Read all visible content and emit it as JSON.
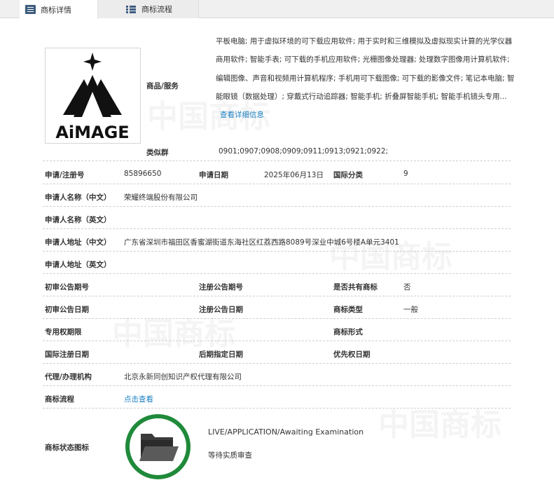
{
  "tabs": [
    {
      "label": "商标详情",
      "active": true
    },
    {
      "label": "商标流程",
      "active": false
    }
  ],
  "watermark": {
    "text": "中国商标"
  },
  "logo": {
    "text": "AiMAGE",
    "color": "#111111"
  },
  "goods": {
    "label": "商品/服务",
    "text": "平板电脑; 用于虚拟环境的可下载应用软件; 用于实时和三维模拟及虚拟现实计算的光学仪器商用软件; 智能手表; 可下载的手机应用软件; 光栅图像处理器; 处理数字图像用计算机软件; 编辑图像、声音和视频用计算机程序; 手机用可下载图像; 可下载的影像文件; 笔记本电脑; 智能眼镜（数据处理）; 穿戴式行动追踪器; 智能手机; 折叠屏智能手机; 智能手机镜头专用...",
    "more_link": "查看详细信息"
  },
  "similar_group": {
    "label": "类似群",
    "value": "0901;0907;0908;0909;0911;0913;0921;0922;"
  },
  "fields": {
    "reg_no_label": "申请/注册号",
    "reg_no": "85896650",
    "app_date_label": "申请日期",
    "app_date": "2025年06月13日",
    "intl_class_label": "国际分类",
    "intl_class": "9",
    "applicant_cn_label": "申请人名称（中文）",
    "applicant_cn": "荣耀终端股份有限公司",
    "applicant_en_label": "申请人名称（英文）",
    "applicant_en": "",
    "address_cn_label": "申请人地址（中文）",
    "address_cn": "广东省深圳市福田区香蜜湖街道东海社区红荔西路8089号深业中城6号楼A单元3401",
    "address_en_label": "申请人地址（英文）",
    "address_en": "",
    "prelim_no_label": "初审公告期号",
    "prelim_no": "",
    "reg_pub_no_label": "注册公告期号",
    "reg_pub_no": "",
    "shared_label": "是否共有商标",
    "shared": "否",
    "prelim_date_label": "初审公告日期",
    "prelim_date": "",
    "reg_pub_date_label": "注册公告日期",
    "reg_pub_date": "",
    "mark_type_label": "商标类型",
    "mark_type": "一般",
    "exclusive_label": "专用权期限",
    "exclusive": "",
    "mark_form_label": "商标形式",
    "mark_form": "",
    "intl_reg_date_label": "国际注册日期",
    "intl_reg_date": "",
    "later_date_label": "后期指定日期",
    "later_date": "",
    "priority_label": "优先权日期",
    "priority": "",
    "agent_label": "代理/办理机构",
    "agent": "北京永新同创知识产权代理有限公司",
    "process_label": "商标流程",
    "process_link": "点击查看",
    "status_icon_label": "商标状态图标",
    "status_en": "LIVE/APPLICATION/Awaiting Examination",
    "status_cn": "等待实质审查"
  },
  "colors": {
    "link": "#1a7fc1",
    "status_ring": "#1f8a3a",
    "tab_icon": "#3e5c7e"
  }
}
